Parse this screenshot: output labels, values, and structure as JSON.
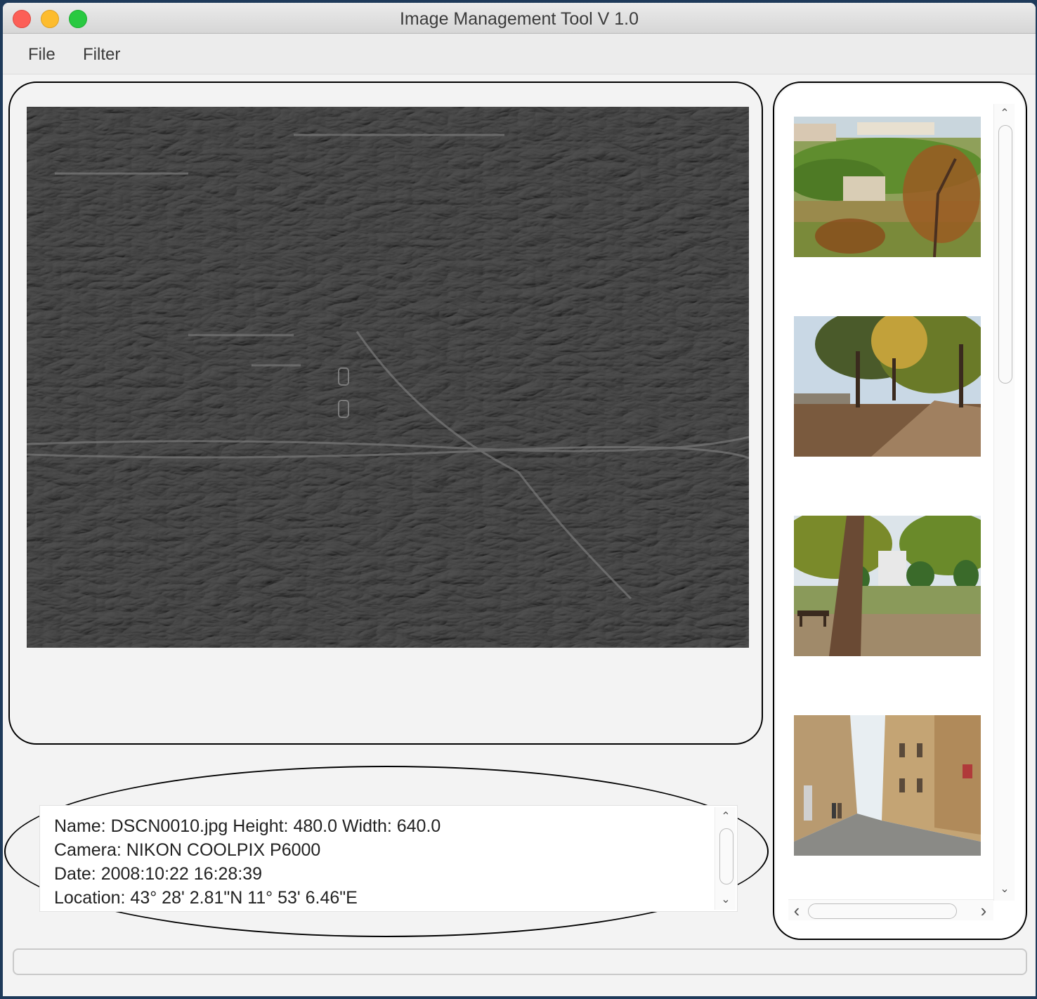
{
  "window": {
    "title": "Image Management Tool V 1.0"
  },
  "menubar": {
    "items": [
      {
        "label": "File"
      },
      {
        "label": "Filter"
      }
    ]
  },
  "metadata": {
    "line1": "Name: DSCN0010.jpg  Height: 480.0  Width: 640.0",
    "line2": "Camera: NIKON COOLPIX P6000",
    "line3": "Date: 2008:10:22 16:28:39",
    "line4": "Location: 43° 28' 2.81\"N  11° 53' 6.46\"E"
  },
  "scrollbars": {
    "up": "⌃",
    "down": "⌄",
    "left": "‹",
    "right": "›"
  },
  "colors": {
    "filtered_image": "#3a3a3a",
    "close": "#fc5f57",
    "minimize": "#fdbc2e",
    "maximize": "#29c941"
  }
}
